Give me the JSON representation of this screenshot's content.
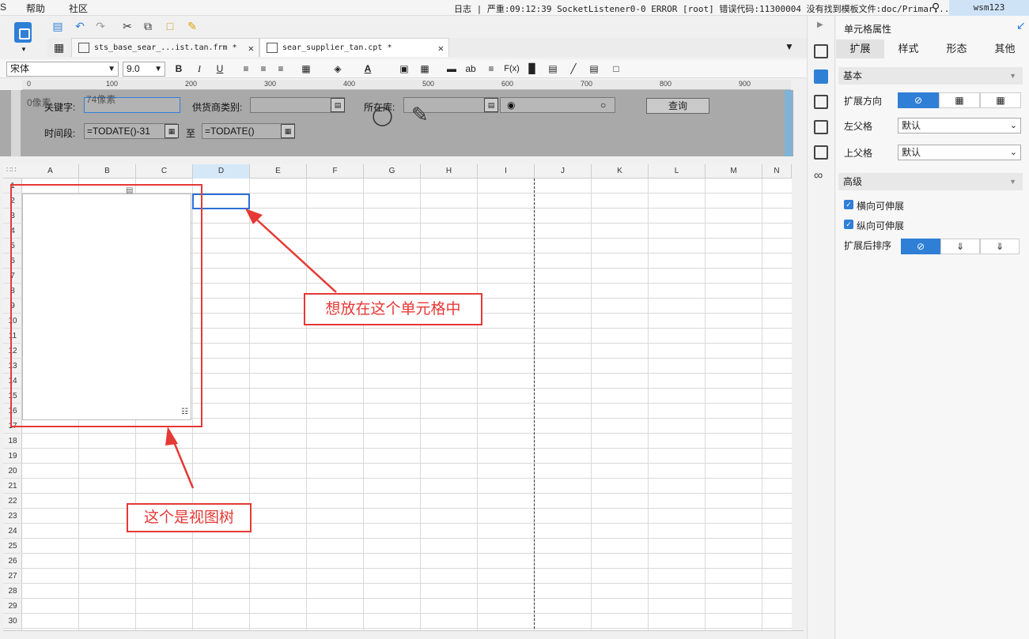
{
  "menu": {
    "items": [
      "帮助",
      "社区"
    ],
    "partial_first": "S"
  },
  "status_bar": {
    "log_label": "日志",
    "message": "| 严重:09:12:39 SocketListener0-0 ERROR [root] 错误代码:11300004 没有找到模板文件:doc/Primar..."
  },
  "user": {
    "name": "wsm123"
  },
  "tabs": [
    {
      "label": "sts_base_sear_...ist.tan.frm *"
    },
    {
      "label": "sear_supplier_tan.cpt *"
    }
  ],
  "format_bar": {
    "font": "宋体",
    "size": "9.0",
    "bold": "B",
    "italic": "I",
    "underline": "U",
    "ab": "ab",
    "fx": "F(x)"
  },
  "ruler": {
    "ticks": [
      "0",
      "100",
      "200",
      "300",
      "400",
      "500",
      "600",
      "700",
      "800",
      "900"
    ]
  },
  "form": {
    "keyword_label": "关键字:",
    "keyword_overlay_left": "0像素",
    "keyword_overlay_top": "74像素",
    "supplier_type_label": "供货商类别:",
    "location_label": "所在库:",
    "query_button": "查询",
    "time_label": "时间段:",
    "date_from": "=TODATE()-31",
    "to_label": "至",
    "date_to": "=TODATE()"
  },
  "grid": {
    "columns": [
      "A",
      "B",
      "C",
      "D",
      "E",
      "F",
      "G",
      "H",
      "I",
      "J",
      "K",
      "L",
      "M",
      "N"
    ],
    "active_column": "D",
    "rows": [
      "1",
      "2",
      "3",
      "4",
      "5",
      "6",
      "7",
      "8",
      "9",
      "10",
      "11",
      "12",
      "13",
      "14",
      "15",
      "16",
      "17",
      "18",
      "19",
      "20",
      "21",
      "22",
      "23",
      "24",
      "25",
      "26",
      "27",
      "28",
      "29",
      "30"
    ]
  },
  "annotations": {
    "target_cell_note": "想放在这个单元格中",
    "tree_note": "这个是视图树"
  },
  "panel": {
    "title": "单元格属性",
    "tabs": [
      "扩展",
      "样式",
      "形态",
      "其他"
    ],
    "active_tab": "扩展",
    "basic_section": "基本",
    "expand_direction_label": "扩展方向",
    "left_parent_label": "左父格",
    "left_parent_value": "默认",
    "top_parent_label": "上父格",
    "top_parent_value": "默认",
    "advanced_section": "高级",
    "h_expand_label": "横向可伸展",
    "v_expand_label": "纵向可伸展",
    "sort_label": "扩展后排序"
  },
  "colors": {
    "accent": "#2f7fd6",
    "annotation": "#e53935"
  }
}
